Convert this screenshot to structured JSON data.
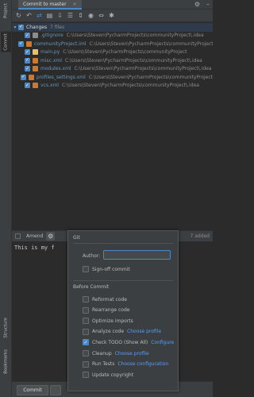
{
  "side_tabs": {
    "project": "Project",
    "commit": "Commit",
    "structure": "Structure",
    "bookmarks": "Bookmarks"
  },
  "tab": {
    "title": "Commit to master",
    "close": "×"
  },
  "tree": {
    "changes_label": "Changes",
    "changes_count": "7 files",
    "files": [
      {
        "name": ".gitignore",
        "path": "C:\\Users\\Steven\\PycharmProjects\\communityProject\\.idea",
        "color": "#6897bb",
        "icon_color": "#8c8c8c"
      },
      {
        "name": "communityProject.iml",
        "path": "C:\\Users\\Steven\\PycharmProjects\\communityProject",
        "color": "#6897bb",
        "icon_color": "#cc7832"
      },
      {
        "name": "main.py",
        "path": "C:\\Users\\Steven\\PycharmProjects\\communityProject",
        "color": "#6897bb",
        "icon_color": "#e8bf6a"
      },
      {
        "name": "misc.xml",
        "path": "C:\\Users\\Steven\\PycharmProjects\\communityProject\\.idea",
        "color": "#6897bb",
        "icon_color": "#cc7832"
      },
      {
        "name": "modules.xml",
        "path": "C:\\Users\\Steven\\PycharmProjects\\communityProject\\.idea",
        "color": "#6897bb",
        "icon_color": "#cc7832"
      },
      {
        "name": "profiles_settings.xml",
        "path": "C:\\Users\\Steven\\PycharmProjects\\communityProject",
        "color": "#6897bb",
        "icon_color": "#cc7832"
      },
      {
        "name": "vcs.xml",
        "path": "C:\\Users\\Steven\\PycharmProjects\\communityProject\\.idea",
        "color": "#6897bb",
        "icon_color": "#cc7832"
      }
    ]
  },
  "amend_label": "Amend",
  "added_label": "7 added",
  "commit_message": "This is my f",
  "commit_button": "Commit",
  "popup": {
    "git_section": "Git",
    "author_label": "Author:",
    "author_value": "",
    "signoff_label": "Sign-off commit",
    "before_commit_section": "Before Commit",
    "options": [
      {
        "label": "Reformat code",
        "checked": false,
        "link": ""
      },
      {
        "label": "Rearrange code",
        "checked": false,
        "link": ""
      },
      {
        "label": "Optimize imports",
        "checked": false,
        "link": ""
      },
      {
        "label": "Analyze code",
        "checked": false,
        "link": "Choose profile"
      },
      {
        "label": "Check TODO (Show All)",
        "checked": true,
        "link": "Configure"
      },
      {
        "label": "Cleanup",
        "checked": false,
        "link": "Choose profile"
      },
      {
        "label": "Run Tests",
        "checked": false,
        "link": "Choose configuration"
      },
      {
        "label": "Update copyright",
        "checked": false,
        "link": ""
      }
    ]
  },
  "colors": {
    "accent": "#4a88c7",
    "background": "#2b2b2b",
    "panel": "#3c3f41",
    "link": "#589df6"
  }
}
